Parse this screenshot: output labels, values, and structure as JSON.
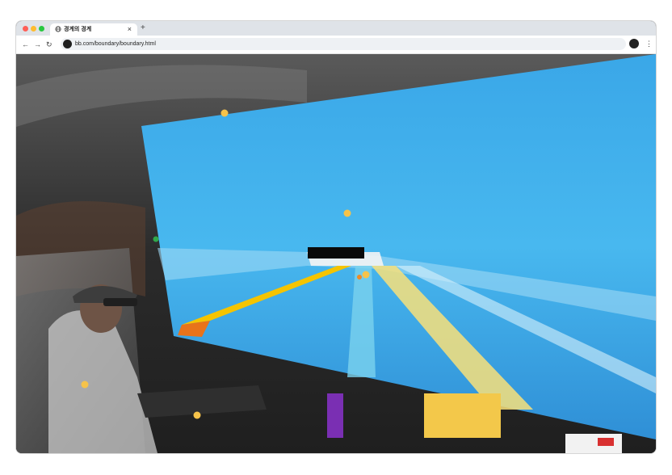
{
  "browser": {
    "tab_title": "경계의 경계",
    "tab_close_label": "×",
    "new_tab_label": "+",
    "url": "bb.com/boundary/boundary.html",
    "back_label": "←",
    "forward_label": "→",
    "reload_label": "↻",
    "menu_label": "⋮"
  },
  "icons": {
    "favicon": "globe-icon",
    "site": "site-logo-icon",
    "profile": "profile-icon"
  },
  "colors": {
    "screen_blue": "#3aa7e8",
    "car_interior": "#3a3a3a",
    "lane_yellow": "#f5c400",
    "lane_orange": "#e8731a",
    "emoji_yellow": "#f6c34a"
  },
  "scene": {
    "emojis": [
      "smiling-face",
      "grinning-face",
      "smiling-face",
      "sad-face",
      "sad-face"
    ]
  }
}
